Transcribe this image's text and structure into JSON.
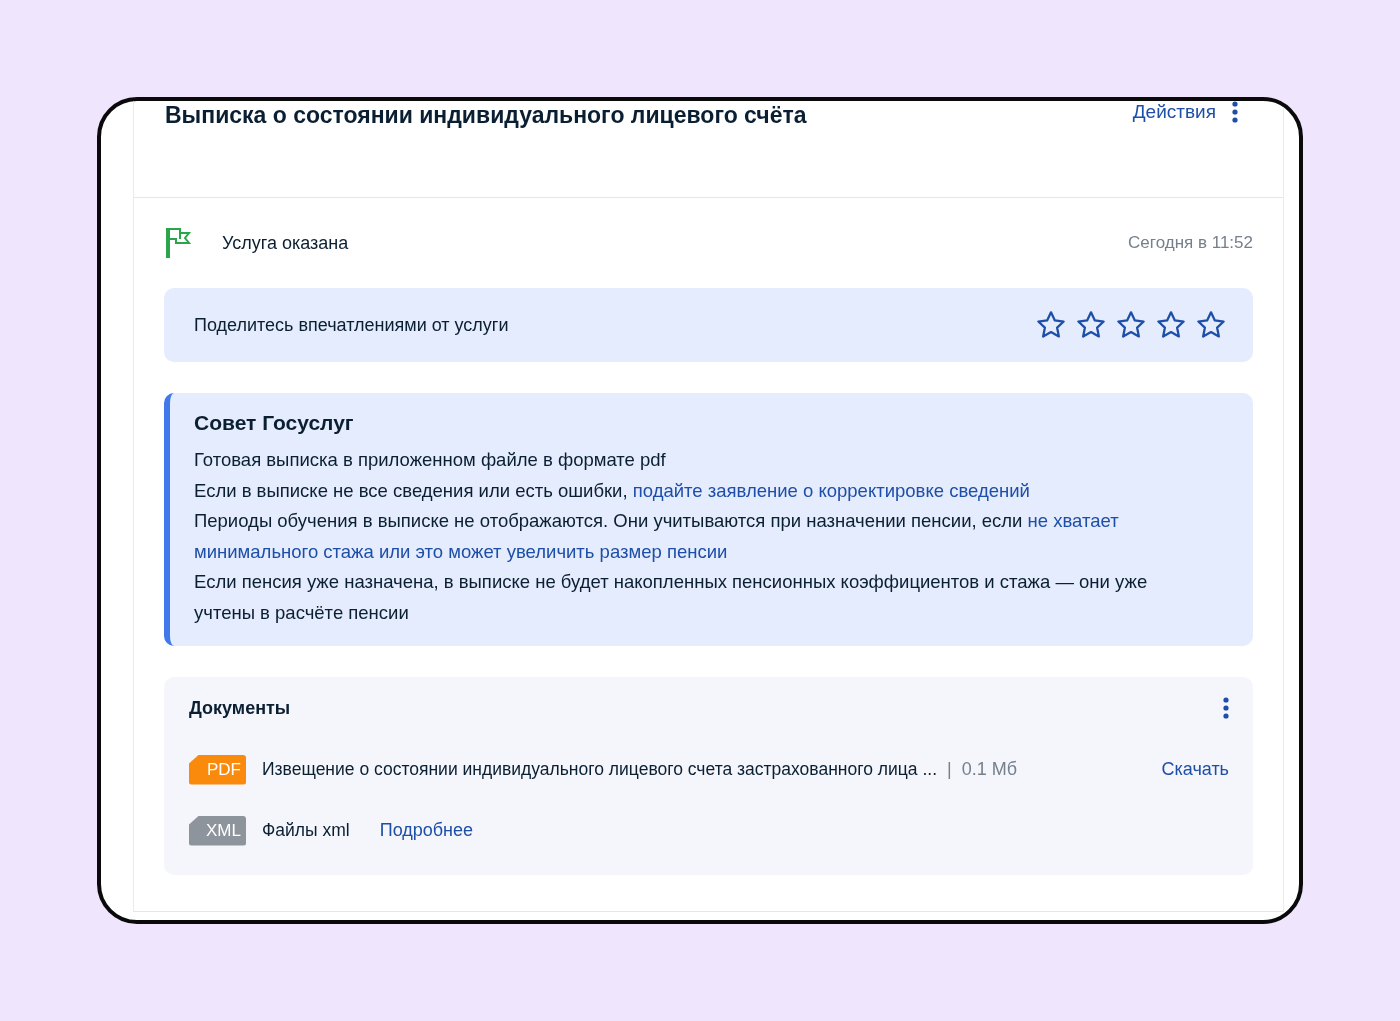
{
  "header": {
    "title": "Выписка о состоянии индивидуального лицевого счёта",
    "actions_label": "Действия"
  },
  "status": {
    "text": "Услуга оказана",
    "time": "Сегодня в 11:52"
  },
  "rating": {
    "prompt": "Поделитесь впечатлениями от услуги",
    "stars": 0
  },
  "tip": {
    "title": "Совет Госуслуг",
    "paragraphs": [
      {
        "text": "Готовая выписка в приложенном файле в формате pdf"
      },
      {
        "text": "Если в выписке не все сведения или есть ошибки, ",
        "link": "подайте заявление о корректировке сведений"
      },
      {
        "text": "Периоды обучения в выписке не отображаются. Они учитываются при назначении пенсии, если ",
        "link": "не хватает",
        "link_continued": "минимального стажа или это может увеличить размер пенсии"
      },
      {
        "text": "Если пенсия уже назначена, в выписке не будет накопленных пенсионных коэффициентов и стажа — они уже учтены в расчёте пенсии"
      }
    ]
  },
  "documents": {
    "title": "Документы",
    "items": [
      {
        "kind": "pdf",
        "badge": "PDF",
        "name": "Извещение о состоянии индивидуального лицевого счета застрахованного лица ...",
        "separator": "|",
        "size": "0.1 Мб",
        "action": "Скачать"
      },
      {
        "kind": "xml",
        "badge": "XML",
        "name": "Файлы xml",
        "action": "Подробнее"
      }
    ]
  }
}
